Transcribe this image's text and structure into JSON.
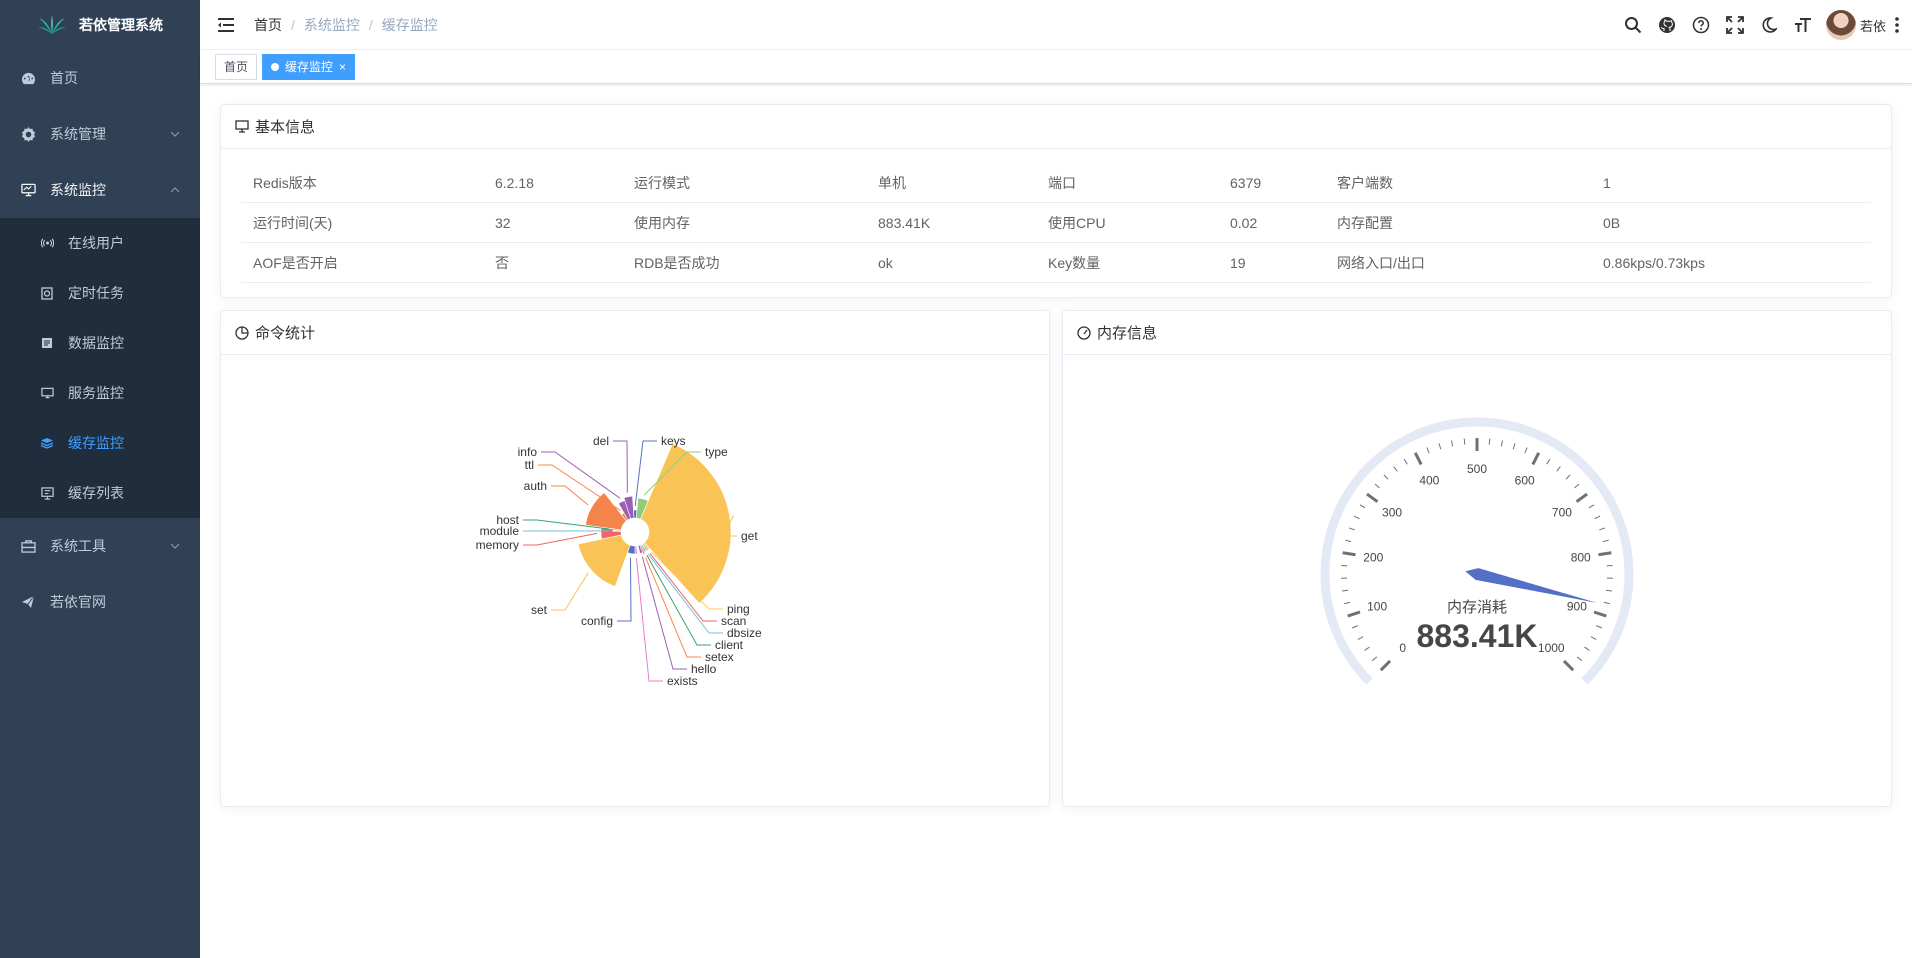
{
  "app": {
    "title": "若依管理系统"
  },
  "sidebar": {
    "items": [
      {
        "label": "首页",
        "icon": "dashboard-icon"
      },
      {
        "label": "系统管理",
        "icon": "gear-icon"
      },
      {
        "label": "系统监控",
        "icon": "monitor-icon"
      },
      {
        "label": "系统工具",
        "icon": "toolbox-icon"
      },
      {
        "label": "若依官网",
        "icon": "send-icon"
      }
    ],
    "monitor_children": [
      {
        "label": "在线用户",
        "icon": "online-icon"
      },
      {
        "label": "定时任务",
        "icon": "job-icon"
      },
      {
        "label": "数据监控",
        "icon": "druid-icon"
      },
      {
        "label": "服务监控",
        "icon": "server-icon"
      },
      {
        "label": "缓存监控",
        "icon": "redis-icon",
        "active": true
      },
      {
        "label": "缓存列表",
        "icon": "list-icon"
      }
    ]
  },
  "navbar": {
    "breadcrumb": [
      "首页",
      "系统监控",
      "缓存监控"
    ],
    "user_name": "若依"
  },
  "tags": {
    "home": "首页",
    "active": "缓存监控"
  },
  "basic": {
    "title": "基本信息",
    "rows": [
      [
        "Redis版本",
        "6.2.18",
        "运行模式",
        "单机",
        "端口",
        "6379",
        "客户端数",
        "1"
      ],
      [
        "运行时间(天)",
        "32",
        "使用内存",
        "883.41K",
        "使用CPU",
        "0.02",
        "内存配置",
        "0B"
      ],
      [
        "AOF是否开启",
        "否",
        "RDB是否成功",
        "ok",
        "Key数量",
        "19",
        "网络入口/出口",
        "0.86kps/0.73kps"
      ]
    ]
  },
  "commands": {
    "title": "命令统计"
  },
  "memory": {
    "title": "内存信息",
    "gauge_label": "内存消耗",
    "gauge_value_text": "883.41K"
  },
  "chart_data": [
    {
      "type": "pie",
      "variant": "nightingale-rose",
      "categories": [
        "get",
        "set",
        "auth",
        "memory",
        "module",
        "host",
        "ttl",
        "info",
        "del",
        "keys",
        "type",
        "ping",
        "scan",
        "dbsize",
        "client",
        "setex",
        "hello",
        "exists",
        "config"
      ],
      "colors": {
        "get": "#f9c356",
        "set": "#f9c356",
        "auth": "#f5844a",
        "memory": "#ee6666",
        "type": "#91cc75",
        "del": "#9a60b4",
        "info": "#9a60b4"
      }
    },
    {
      "type": "gauge",
      "min": 0,
      "max": 1000,
      "value": 883.41,
      "ticks": [
        "0",
        "100",
        "200",
        "300",
        "400",
        "500",
        "600",
        "700",
        "800",
        "900",
        "1000"
      ],
      "label": "内存消耗",
      "detail": "883.41K",
      "colors": {
        "ring": "#e3eaf6",
        "pointer": "#5470c6",
        "tick": "#6e7079"
      }
    }
  ]
}
